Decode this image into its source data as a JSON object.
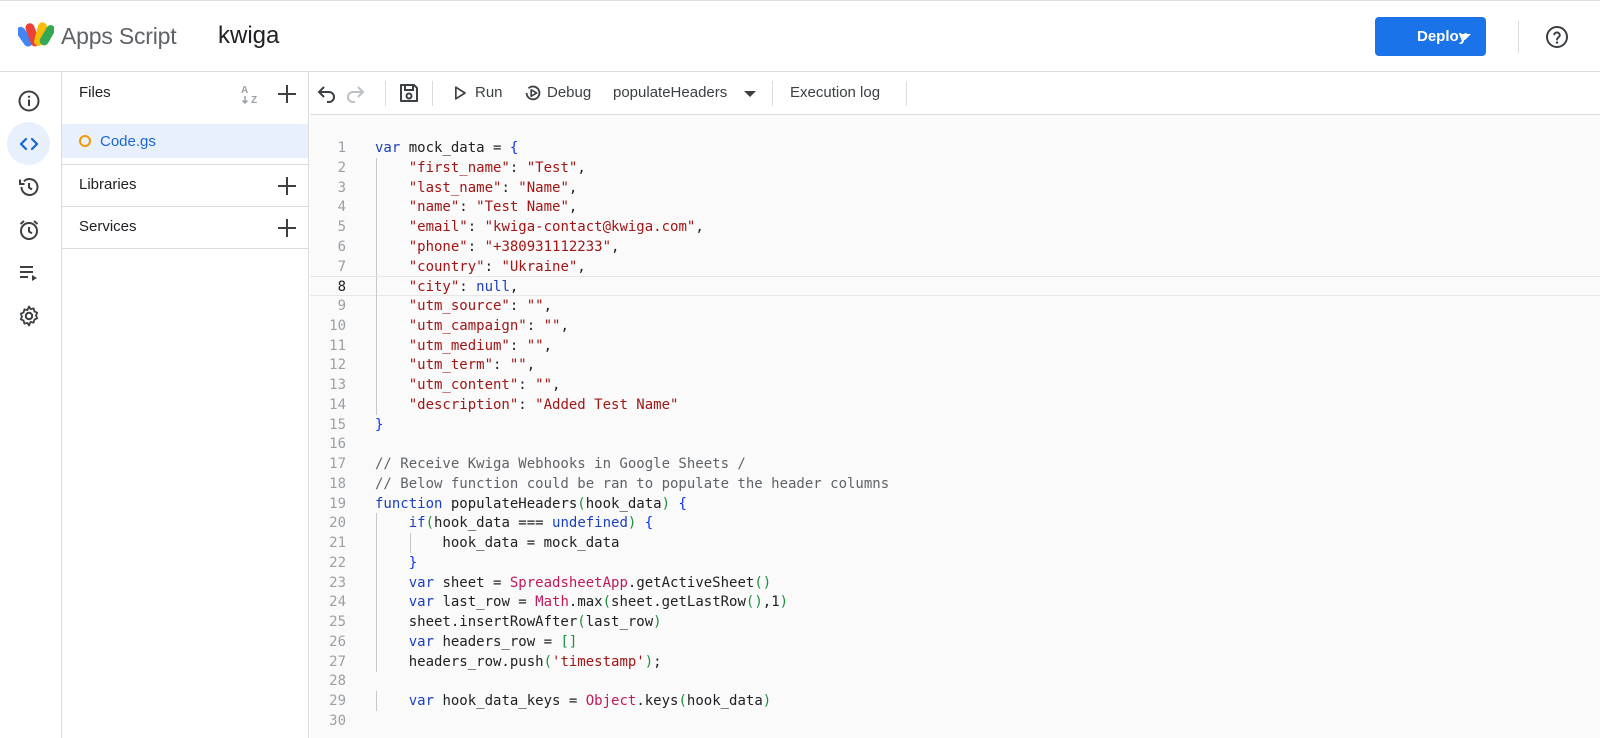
{
  "header": {
    "brand": "Apps Script",
    "project": "kwiga",
    "deploy_label": "Deploy",
    "help_icon": "help-icon"
  },
  "rail": {
    "items": [
      {
        "name": "overview",
        "icon": "info-icon",
        "active": false
      },
      {
        "name": "editor",
        "icon": "code-icon",
        "active": true
      },
      {
        "name": "triggers-history",
        "icon": "history-icon",
        "active": false
      },
      {
        "name": "triggers",
        "icon": "alarm-icon",
        "active": false
      },
      {
        "name": "executions",
        "icon": "executions-icon",
        "active": false
      },
      {
        "name": "settings",
        "icon": "gear-icon",
        "active": false
      }
    ]
  },
  "files_panel": {
    "files_title": "Files",
    "file": "Code.gs",
    "libraries_title": "Libraries",
    "services_title": "Services"
  },
  "toolbar": {
    "run_label": "Run",
    "debug_label": "Debug",
    "function_name": "populateHeaders",
    "execution_log_label": "Execution log"
  },
  "editor": {
    "current_line": 8,
    "lines": [
      "var mock_data = {",
      "    \"first_name\": \"Test\",",
      "    \"last_name\": \"Name\",",
      "    \"name\": \"Test Name\",",
      "    \"email\": \"kwiga-contact@kwiga.com\",",
      "    \"phone\": \"+380931112233\",",
      "    \"country\": \"Ukraine\",",
      "    \"city\": null,",
      "    \"utm_source\": \"\",",
      "    \"utm_campaign\": \"\",",
      "    \"utm_medium\": \"\",",
      "    \"utm_term\": \"\",",
      "    \"utm_content\": \"\",",
      "    \"description\": \"Added Test Name\"",
      "}",
      "",
      "// Receive Kwiga Webhooks in Google Sheets /",
      "// Below function could be ran to populate the header columns",
      "function populateHeaders(hook_data) {",
      "    if(hook_data === undefined) {",
      "        hook_data = mock_data",
      "    }",
      "    var sheet = SpreadsheetApp.getActiveSheet()",
      "    var last_row = Math.max(sheet.getLastRow(),1)",
      "    sheet.insertRowAfter(last_row)",
      "    var headers_row = []",
      "    headers_row.push('timestamp');",
      "",
      "    var hook_data_keys = Object.keys(hook_data)",
      ""
    ]
  }
}
